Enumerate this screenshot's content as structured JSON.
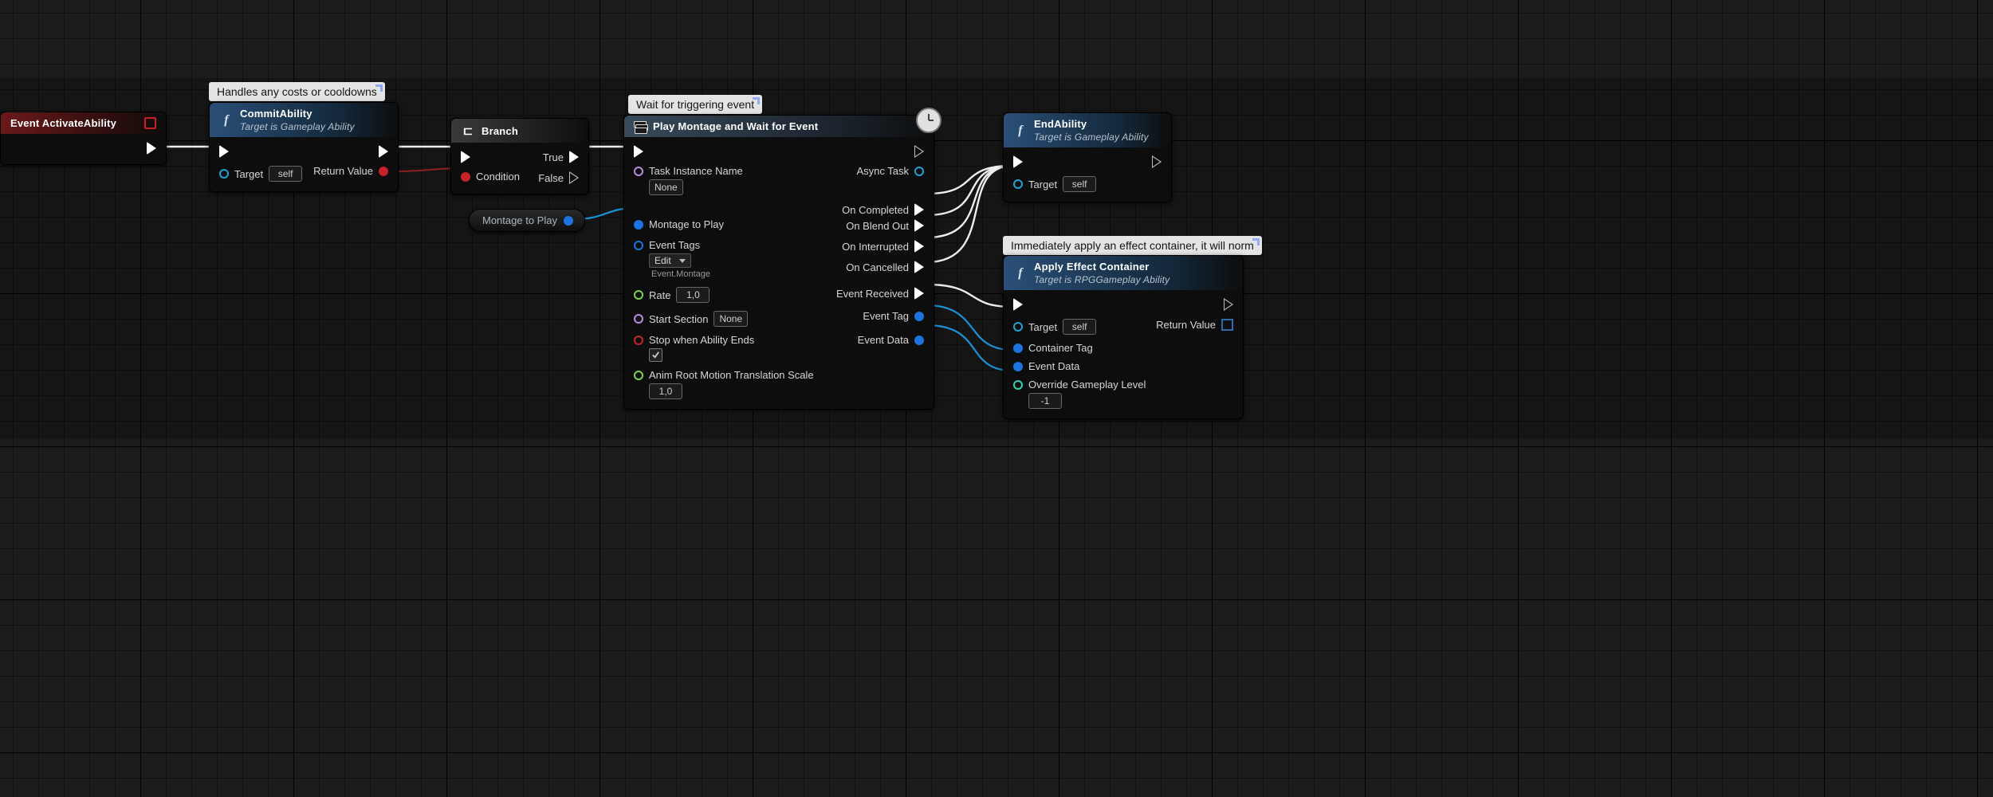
{
  "comments": {
    "commit": "Handles any costs or cooldowns",
    "wait": "Wait for triggering event",
    "apply": "Immediately apply an effect container, it will norm"
  },
  "nodes": {
    "activate": {
      "title": "Event ActivateAbility"
    },
    "commit": {
      "title": "CommitAbility",
      "subtitle": "Target is Gameplay Ability",
      "in_target": "Target",
      "in_target_val": "self",
      "out_return": "Return Value"
    },
    "branch": {
      "title": "Branch",
      "in_cond": "Condition",
      "out_true": "True",
      "out_false": "False"
    },
    "knot_montage": "Montage to Play",
    "montage": {
      "title": "Play Montage and Wait for Event",
      "in_taskname": "Task Instance Name",
      "in_taskname_val": "None",
      "in_montage": "Montage to Play",
      "in_tags": "Event Tags",
      "in_tags_val": "Edit",
      "in_tags_sub": "Event.Montage",
      "in_rate": "Rate",
      "in_rate_val": "1,0",
      "in_start": "Start Section",
      "in_start_val": "None",
      "in_stop": "Stop when Ability Ends",
      "in_anim": "Anim Root Motion Translation Scale",
      "in_anim_val": "1,0",
      "out_async": "Async Task",
      "out_completed": "On Completed",
      "out_blend": "On Blend Out",
      "out_interrupt": "On Interrupted",
      "out_cancel": "On Cancelled",
      "out_received": "Event Received",
      "out_tag": "Event Tag",
      "out_data": "Event Data"
    },
    "end": {
      "title": "EndAbility",
      "subtitle": "Target is Gameplay Ability",
      "in_target": "Target",
      "in_target_val": "self"
    },
    "apply": {
      "title": "Apply Effect Container",
      "subtitle": "Target is RPGGameplay Ability",
      "in_target": "Target",
      "in_target_val": "self",
      "in_ctag": "Container Tag",
      "in_edata": "Event Data",
      "in_level": "Override Gameplay Level",
      "in_level_val": "-1",
      "out_return": "Return Value"
    }
  }
}
